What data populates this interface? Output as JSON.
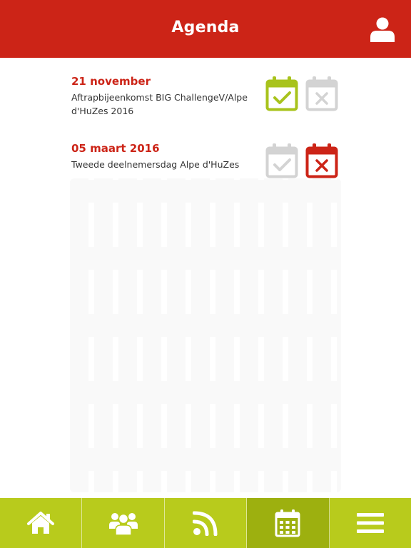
{
  "header": {
    "title": "Agenda",
    "background_color": "#cc2417",
    "profile_icon": "user-icon"
  },
  "events": [
    {
      "date": "21 november",
      "description": "Aftrapbijeenkomst BIG ChallengeV/Alpe d'HuZes 2016",
      "status": "accepted",
      "accept_icon": "calendar-check-icon",
      "decline_icon": "calendar-x-icon"
    },
    {
      "date": "05 maart 2016",
      "description": "Tweede deelnemersdag Alpe d'HuZes",
      "status": "declined",
      "accept_icon": "calendar-check-icon",
      "decline_icon": "calendar-x-icon"
    }
  ],
  "colors": {
    "accent_red": "#cc2417",
    "accept_green": "#a8c31c",
    "inactive_gray": "#cfcfcf",
    "tabbar_green": "#b8cb1c",
    "tabbar_active": "#9db00f"
  },
  "tabbar": {
    "active_tab": "agenda",
    "tabs": [
      {
        "id": "home",
        "icon": "home-icon"
      },
      {
        "id": "team",
        "icon": "group-icon"
      },
      {
        "id": "news",
        "icon": "rss-icon"
      },
      {
        "id": "agenda",
        "icon": "calendar-icon"
      },
      {
        "id": "menu",
        "icon": "menu-icon"
      }
    ]
  }
}
